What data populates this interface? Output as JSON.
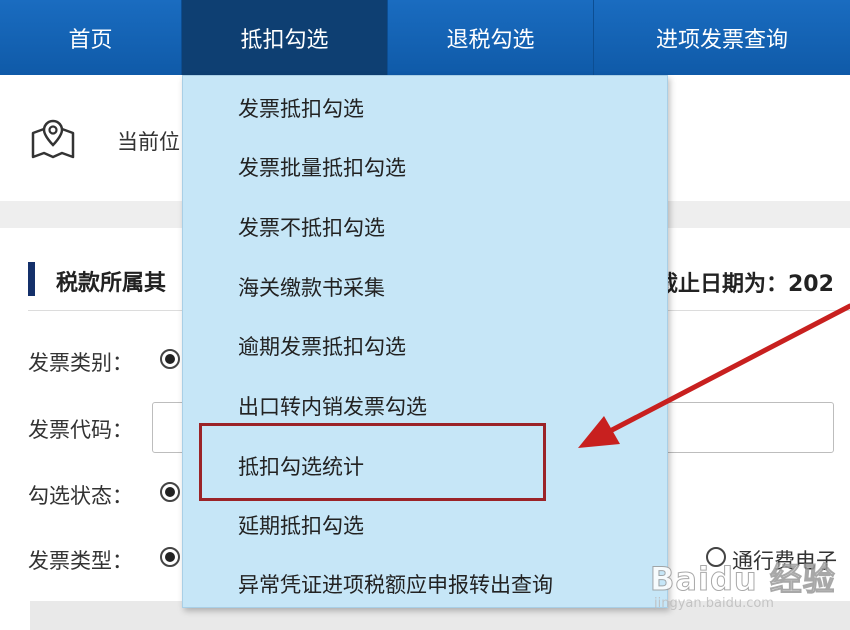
{
  "nav": {
    "items": [
      {
        "label": "首页"
      },
      {
        "label": "抵扣勾选"
      },
      {
        "label": "退税勾选"
      },
      {
        "label": "进项发票查询"
      }
    ]
  },
  "location": {
    "text": "当前位",
    "icon": "map-location-icon"
  },
  "section": {
    "title": "税款所属其",
    "deadline": "截止日期为：202"
  },
  "form": {
    "invoice_category_label": "发票类别：",
    "invoice_code_label": "发票代码：",
    "check_status_label": "勾选状态：",
    "invoice_type_label": "发票类型：",
    "toll_option_label": "通行费电子"
  },
  "dropdown": {
    "items": [
      {
        "label": "发票抵扣勾选"
      },
      {
        "label": "发票批量抵扣勾选"
      },
      {
        "label": "发票不抵扣勾选"
      },
      {
        "label": "海关缴款书采集"
      },
      {
        "label": "逾期发票抵扣勾选"
      },
      {
        "label": "出口转内销发票勾选"
      },
      {
        "label": "抵扣勾选统计"
      },
      {
        "label": "延期抵扣勾选"
      },
      {
        "label": "异常凭证进项税额应申报转出查询"
      }
    ]
  },
  "annotation": {
    "highlight_color": "#9b2327",
    "arrow_color": "#c8201f"
  },
  "watermark": {
    "brand": "Baidu 经验",
    "url": "jingyan.baidu.com"
  },
  "colors": {
    "nav_bg": "#0f5aa8",
    "nav_active": "#0e3f72",
    "dropdown_bg": "#c6e6f7",
    "section_bar": "#14306a"
  }
}
